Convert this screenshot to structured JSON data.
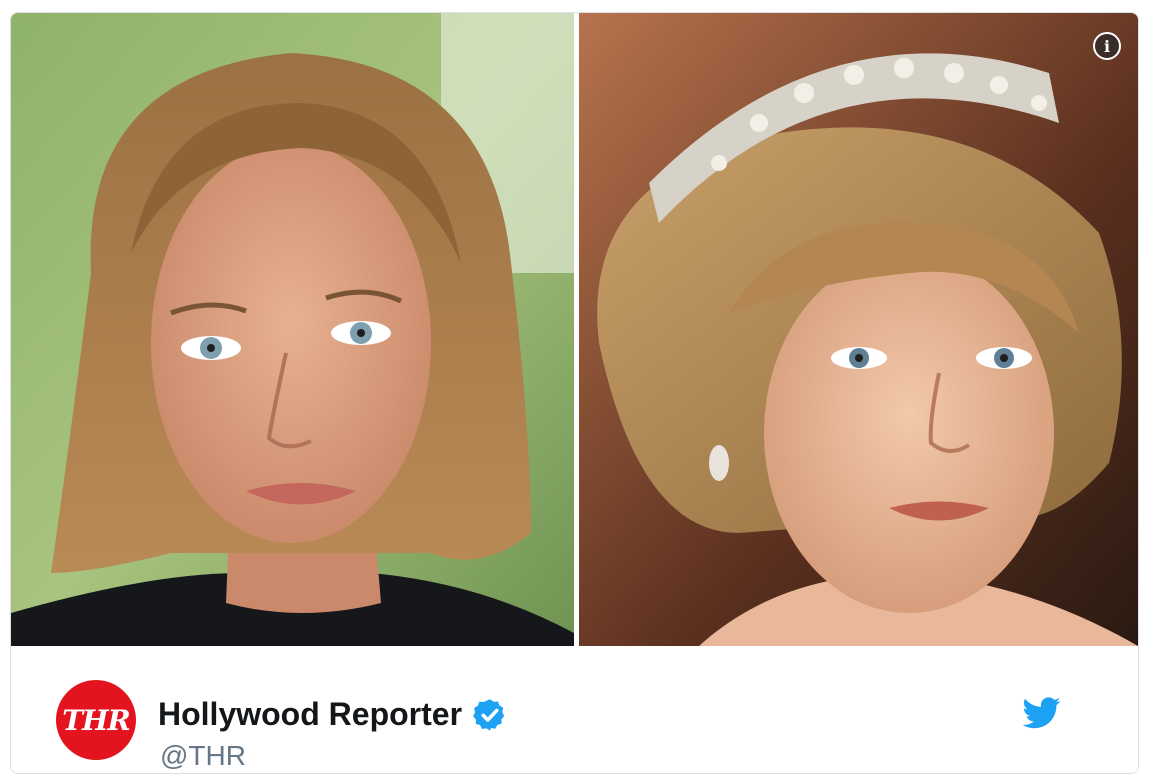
{
  "media": {
    "photos": [
      {
        "name": "portrait-left"
      },
      {
        "name": "portrait-right"
      }
    ],
    "info_icon": "info-icon",
    "info_glyph": "i"
  },
  "author": {
    "avatar_text": "THR",
    "display_name": "Hollywood Reporter",
    "handle": "@THR",
    "verified_icon": "verified-badge-icon",
    "brand_icon": "twitter-bird-icon"
  },
  "colors": {
    "avatar_bg": "#e3141f",
    "verified": "#1da1f2",
    "twitter": "#1da1f2",
    "handle": "#657786",
    "name": "#14171a"
  }
}
